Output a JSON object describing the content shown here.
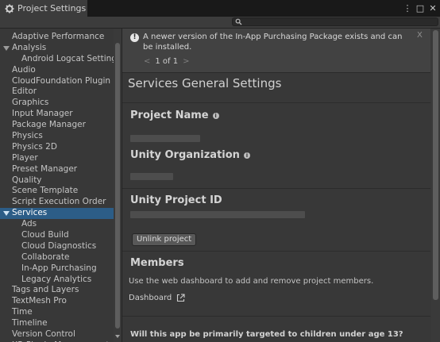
{
  "window": {
    "tab_title": "Project Settings",
    "tab_icon": "gear-icon",
    "controls": [
      {
        "name": "more-icon",
        "glyph": "⋮"
      },
      {
        "name": "maximize-icon",
        "glyph": "□"
      },
      {
        "name": "close-icon",
        "glyph": "✕"
      }
    ]
  },
  "search": {
    "placeholder": "",
    "value": ""
  },
  "sidebar": {
    "items": [
      {
        "label": "Adaptive Performance",
        "level": 0
      },
      {
        "label": "Analysis",
        "level": 0,
        "expanded": true
      },
      {
        "label": "Android Logcat Settings",
        "level": 1
      },
      {
        "label": "Audio",
        "level": 0
      },
      {
        "label": "CloudFoundation Plugin",
        "level": 0
      },
      {
        "label": "Editor",
        "level": 0
      },
      {
        "label": "Graphics",
        "level": 0
      },
      {
        "label": "Input Manager",
        "level": 0
      },
      {
        "label": "Package Manager",
        "level": 0
      },
      {
        "label": "Physics",
        "level": 0
      },
      {
        "label": "Physics 2D",
        "level": 0
      },
      {
        "label": "Player",
        "level": 0
      },
      {
        "label": "Preset Manager",
        "level": 0
      },
      {
        "label": "Quality",
        "level": 0
      },
      {
        "label": "Scene Template",
        "level": 0
      },
      {
        "label": "Script Execution Order",
        "level": 0
      },
      {
        "label": "Services",
        "level": 0,
        "expanded": true,
        "selected": true
      },
      {
        "label": "Ads",
        "level": 1
      },
      {
        "label": "Cloud Build",
        "level": 1
      },
      {
        "label": "Cloud Diagnostics",
        "level": 1
      },
      {
        "label": "Collaborate",
        "level": 1
      },
      {
        "label": "In-App Purchasing",
        "level": 1
      },
      {
        "label": "Legacy Analytics",
        "level": 1
      },
      {
        "label": "Tags and Layers",
        "level": 0
      },
      {
        "label": "TextMesh Pro",
        "level": 0
      },
      {
        "label": "Time",
        "level": 0
      },
      {
        "label": "Timeline",
        "level": 0
      },
      {
        "label": "Version Control",
        "level": 0
      },
      {
        "label": "XR Plugin Management",
        "level": 0
      }
    ]
  },
  "notice": {
    "text": "A newer version of the In-App Purchasing Package exists and can be installed.",
    "close": "X",
    "pager": {
      "prev": "<",
      "label": "1 of 1",
      "next": ">"
    }
  },
  "main": {
    "title": "Services General Settings",
    "project_name": {
      "heading": "Project Name"
    },
    "organization": {
      "heading": "Unity Organization"
    },
    "project_id": {
      "heading": "Unity Project ID",
      "unlink_label": "Unlink project"
    },
    "members": {
      "heading": "Members",
      "description": "Use the web dashboard to add and remove project members.",
      "dashboard_label": "Dashboard"
    },
    "children_question": "Will this app be primarily targeted to children under age 13?"
  },
  "colors": {
    "selection": "#2c5d87",
    "panel": "#383838",
    "notice": "#424242"
  }
}
